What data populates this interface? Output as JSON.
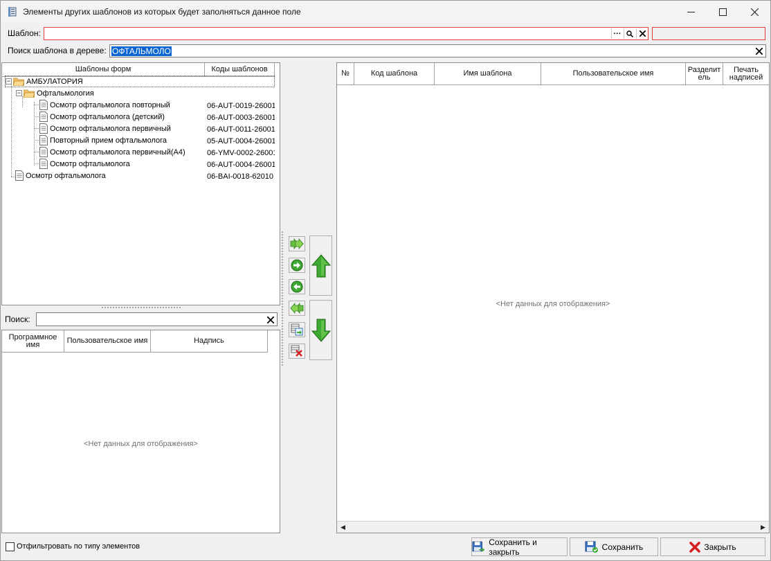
{
  "window": {
    "title": "Элементы других шаблонов из которых будет заполняться данное поле",
    "minimize": "—",
    "maximize": "☐",
    "close": "✕"
  },
  "template_field": {
    "label": "Шаблон:",
    "value": "",
    "browse_glyph": "···",
    "search_glyph": "🔍",
    "clear_glyph": "✕"
  },
  "tree_search": {
    "label": "Поиск шаблона в дереве:",
    "value": "ОФТАЛЬМОЛО",
    "clear_glyph": "✕"
  },
  "tree": {
    "columns": [
      "Шаблоны форм",
      "Коды шаблонов"
    ],
    "root": {
      "label": "АМБУЛАТОРИЯ",
      "expander": "−"
    },
    "folder": {
      "label": "Офтальмология",
      "expander": "−"
    },
    "items": [
      {
        "name": "Осмотр офтальмолога повторный",
        "code": "06-AUT-0019-26001"
      },
      {
        "name": "Осмотр офтальмолога (детский)",
        "code": "06-AUT-0003-26001"
      },
      {
        "name": "Осмотр офтальмолога первичный",
        "code": "06-AUT-0011-26001"
      },
      {
        "name": "Повторный прием офтальмолога",
        "code": "05-AUT-0004-26001"
      },
      {
        "name": "Осмотр офтальмолога первичный(А4)",
        "code": "06-YMV-0002-26001"
      },
      {
        "name": "Осмотр офтальмолога",
        "code": "06-AUT-0004-26001"
      }
    ],
    "extra_item": {
      "name": "Осмотр офтальмолога",
      "code": "06-BAI-0018-62010"
    }
  },
  "elements_search": {
    "label": "Поиск:",
    "value": "",
    "clear_glyph": "✕"
  },
  "elements_grid": {
    "columns": [
      "Программное имя",
      "Пользовательское имя",
      "Надпись"
    ],
    "empty_text": "<Нет данных для отображения>"
  },
  "result_grid": {
    "columns": [
      "№",
      "Код шаблона",
      "Имя шаблона",
      "Пользовательское имя",
      "Разделитель",
      "Печать надписей"
    ],
    "empty_text": "<Нет данных для отображения>",
    "scroll_left": "◀",
    "scroll_right": "▶"
  },
  "filter_checkbox": {
    "label": "Отфильтровать по типу элементов",
    "checked": false
  },
  "buttons": {
    "save_close": "Сохранить и закрыть",
    "save": "Сохранить",
    "close": "Закрыть"
  },
  "colors": {
    "accent_green": "#3da832",
    "error_border": "#e23b3b",
    "selection": "#0a64d2",
    "close_red": "#d42020"
  }
}
